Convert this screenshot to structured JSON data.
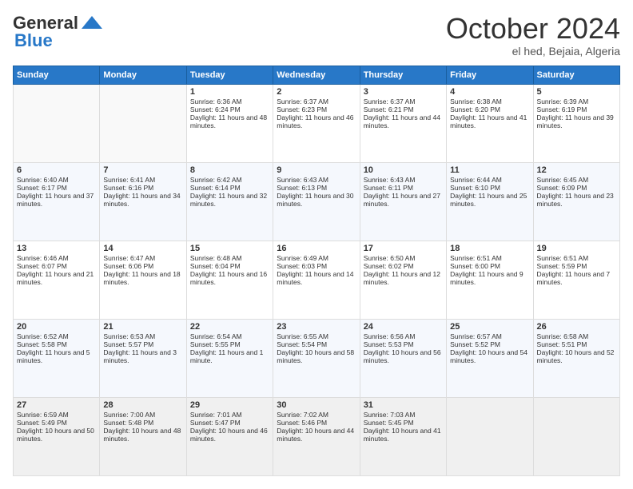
{
  "header": {
    "logo_line1": "General",
    "logo_line2": "Blue",
    "title": "October 2024",
    "subtitle": "el hed, Bejaia, Algeria"
  },
  "weekdays": [
    "Sunday",
    "Monday",
    "Tuesday",
    "Wednesday",
    "Thursday",
    "Friday",
    "Saturday"
  ],
  "weeks": [
    [
      {
        "day": "",
        "empty": true
      },
      {
        "day": "",
        "empty": true
      },
      {
        "day": "1",
        "sunrise": "Sunrise: 6:36 AM",
        "sunset": "Sunset: 6:24 PM",
        "daylight": "Daylight: 11 hours and 48 minutes."
      },
      {
        "day": "2",
        "sunrise": "Sunrise: 6:37 AM",
        "sunset": "Sunset: 6:23 PM",
        "daylight": "Daylight: 11 hours and 46 minutes."
      },
      {
        "day": "3",
        "sunrise": "Sunrise: 6:37 AM",
        "sunset": "Sunset: 6:21 PM",
        "daylight": "Daylight: 11 hours and 44 minutes."
      },
      {
        "day": "4",
        "sunrise": "Sunrise: 6:38 AM",
        "sunset": "Sunset: 6:20 PM",
        "daylight": "Daylight: 11 hours and 41 minutes."
      },
      {
        "day": "5",
        "sunrise": "Sunrise: 6:39 AM",
        "sunset": "Sunset: 6:19 PM",
        "daylight": "Daylight: 11 hours and 39 minutes."
      }
    ],
    [
      {
        "day": "6",
        "sunrise": "Sunrise: 6:40 AM",
        "sunset": "Sunset: 6:17 PM",
        "daylight": "Daylight: 11 hours and 37 minutes."
      },
      {
        "day": "7",
        "sunrise": "Sunrise: 6:41 AM",
        "sunset": "Sunset: 6:16 PM",
        "daylight": "Daylight: 11 hours and 34 minutes."
      },
      {
        "day": "8",
        "sunrise": "Sunrise: 6:42 AM",
        "sunset": "Sunset: 6:14 PM",
        "daylight": "Daylight: 11 hours and 32 minutes."
      },
      {
        "day": "9",
        "sunrise": "Sunrise: 6:43 AM",
        "sunset": "Sunset: 6:13 PM",
        "daylight": "Daylight: 11 hours and 30 minutes."
      },
      {
        "day": "10",
        "sunrise": "Sunrise: 6:43 AM",
        "sunset": "Sunset: 6:11 PM",
        "daylight": "Daylight: 11 hours and 27 minutes."
      },
      {
        "day": "11",
        "sunrise": "Sunrise: 6:44 AM",
        "sunset": "Sunset: 6:10 PM",
        "daylight": "Daylight: 11 hours and 25 minutes."
      },
      {
        "day": "12",
        "sunrise": "Sunrise: 6:45 AM",
        "sunset": "Sunset: 6:09 PM",
        "daylight": "Daylight: 11 hours and 23 minutes."
      }
    ],
    [
      {
        "day": "13",
        "sunrise": "Sunrise: 6:46 AM",
        "sunset": "Sunset: 6:07 PM",
        "daylight": "Daylight: 11 hours and 21 minutes."
      },
      {
        "day": "14",
        "sunrise": "Sunrise: 6:47 AM",
        "sunset": "Sunset: 6:06 PM",
        "daylight": "Daylight: 11 hours and 18 minutes."
      },
      {
        "day": "15",
        "sunrise": "Sunrise: 6:48 AM",
        "sunset": "Sunset: 6:04 PM",
        "daylight": "Daylight: 11 hours and 16 minutes."
      },
      {
        "day": "16",
        "sunrise": "Sunrise: 6:49 AM",
        "sunset": "Sunset: 6:03 PM",
        "daylight": "Daylight: 11 hours and 14 minutes."
      },
      {
        "day": "17",
        "sunrise": "Sunrise: 6:50 AM",
        "sunset": "Sunset: 6:02 PM",
        "daylight": "Daylight: 11 hours and 12 minutes."
      },
      {
        "day": "18",
        "sunrise": "Sunrise: 6:51 AM",
        "sunset": "Sunset: 6:00 PM",
        "daylight": "Daylight: 11 hours and 9 minutes."
      },
      {
        "day": "19",
        "sunrise": "Sunrise: 6:51 AM",
        "sunset": "Sunset: 5:59 PM",
        "daylight": "Daylight: 11 hours and 7 minutes."
      }
    ],
    [
      {
        "day": "20",
        "sunrise": "Sunrise: 6:52 AM",
        "sunset": "Sunset: 5:58 PM",
        "daylight": "Daylight: 11 hours and 5 minutes."
      },
      {
        "day": "21",
        "sunrise": "Sunrise: 6:53 AM",
        "sunset": "Sunset: 5:57 PM",
        "daylight": "Daylight: 11 hours and 3 minutes."
      },
      {
        "day": "22",
        "sunrise": "Sunrise: 6:54 AM",
        "sunset": "Sunset: 5:55 PM",
        "daylight": "Daylight: 11 hours and 1 minute."
      },
      {
        "day": "23",
        "sunrise": "Sunrise: 6:55 AM",
        "sunset": "Sunset: 5:54 PM",
        "daylight": "Daylight: 10 hours and 58 minutes."
      },
      {
        "day": "24",
        "sunrise": "Sunrise: 6:56 AM",
        "sunset": "Sunset: 5:53 PM",
        "daylight": "Daylight: 10 hours and 56 minutes."
      },
      {
        "day": "25",
        "sunrise": "Sunrise: 6:57 AM",
        "sunset": "Sunset: 5:52 PM",
        "daylight": "Daylight: 10 hours and 54 minutes."
      },
      {
        "day": "26",
        "sunrise": "Sunrise: 6:58 AM",
        "sunset": "Sunset: 5:51 PM",
        "daylight": "Daylight: 10 hours and 52 minutes."
      }
    ],
    [
      {
        "day": "27",
        "sunrise": "Sunrise: 6:59 AM",
        "sunset": "Sunset: 5:49 PM",
        "daylight": "Daylight: 10 hours and 50 minutes."
      },
      {
        "day": "28",
        "sunrise": "Sunrise: 7:00 AM",
        "sunset": "Sunset: 5:48 PM",
        "daylight": "Daylight: 10 hours and 48 minutes."
      },
      {
        "day": "29",
        "sunrise": "Sunrise: 7:01 AM",
        "sunset": "Sunset: 5:47 PM",
        "daylight": "Daylight: 10 hours and 46 minutes."
      },
      {
        "day": "30",
        "sunrise": "Sunrise: 7:02 AM",
        "sunset": "Sunset: 5:46 PM",
        "daylight": "Daylight: 10 hours and 44 minutes."
      },
      {
        "day": "31",
        "sunrise": "Sunrise: 7:03 AM",
        "sunset": "Sunset: 5:45 PM",
        "daylight": "Daylight: 10 hours and 41 minutes."
      },
      {
        "day": "",
        "empty": true
      },
      {
        "day": "",
        "empty": true
      }
    ]
  ]
}
